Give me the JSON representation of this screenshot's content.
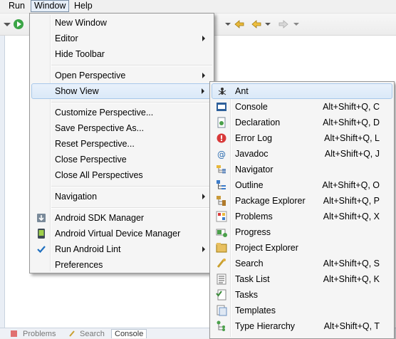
{
  "menubar": {
    "items": [
      "Run",
      "Window",
      "Help"
    ]
  },
  "window_menu": {
    "items": [
      {
        "label": "New Window"
      },
      {
        "label": "Editor"
      },
      {
        "label": "Hide Toolbar"
      },
      {
        "label": "Open Perspective"
      },
      {
        "label": "Show View"
      },
      {
        "label": "Customize Perspective..."
      },
      {
        "label": "Save Perspective As..."
      },
      {
        "label": "Reset Perspective..."
      },
      {
        "label": "Close Perspective"
      },
      {
        "label": "Close All Perspectives"
      },
      {
        "label": "Navigation"
      },
      {
        "label": "Android SDK Manager"
      },
      {
        "label": "Android Virtual Device Manager"
      },
      {
        "label": "Run Android Lint"
      },
      {
        "label": "Preferences"
      }
    ]
  },
  "show_view_menu": {
    "items": [
      {
        "label": "Ant",
        "accel": "",
        "icon": "ant-icon"
      },
      {
        "label": "Console",
        "accel": "Alt+Shift+Q, C",
        "icon": "console-icon"
      },
      {
        "label": "Declaration",
        "accel": "Alt+Shift+Q, D",
        "icon": "declaration-icon"
      },
      {
        "label": "Error Log",
        "accel": "Alt+Shift+Q, L",
        "icon": "error-log-icon"
      },
      {
        "label": "Javadoc",
        "accel": "Alt+Shift+Q, J",
        "icon": "javadoc-icon"
      },
      {
        "label": "Navigator",
        "accel": "",
        "icon": "navigator-icon"
      },
      {
        "label": "Outline",
        "accel": "Alt+Shift+Q, O",
        "icon": "outline-icon"
      },
      {
        "label": "Package Explorer",
        "accel": "Alt+Shift+Q, P",
        "icon": "package-explorer-icon"
      },
      {
        "label": "Problems",
        "accel": "Alt+Shift+Q, X",
        "icon": "problems-icon"
      },
      {
        "label": "Progress",
        "accel": "",
        "icon": "progress-icon"
      },
      {
        "label": "Project Explorer",
        "accel": "",
        "icon": "project-explorer-icon"
      },
      {
        "label": "Search",
        "accel": "Alt+Shift+Q, S",
        "icon": "search-icon"
      },
      {
        "label": "Task List",
        "accel": "Alt+Shift+Q, K",
        "icon": "task-list-icon"
      },
      {
        "label": "Tasks",
        "accel": "",
        "icon": "tasks-icon"
      },
      {
        "label": "Templates",
        "accel": "",
        "icon": "templates-icon"
      },
      {
        "label": "Type Hierarchy",
        "accel": "Alt+Shift+Q, T",
        "icon": "type-hierarchy-icon"
      }
    ]
  },
  "bottom_tabs": [
    "Problems",
    "Search",
    "Console"
  ],
  "colors": {
    "menu_bg": "#f5f5f5",
    "hover_bg": "#dbe9f8",
    "hover_border": "#a8c8ea"
  }
}
